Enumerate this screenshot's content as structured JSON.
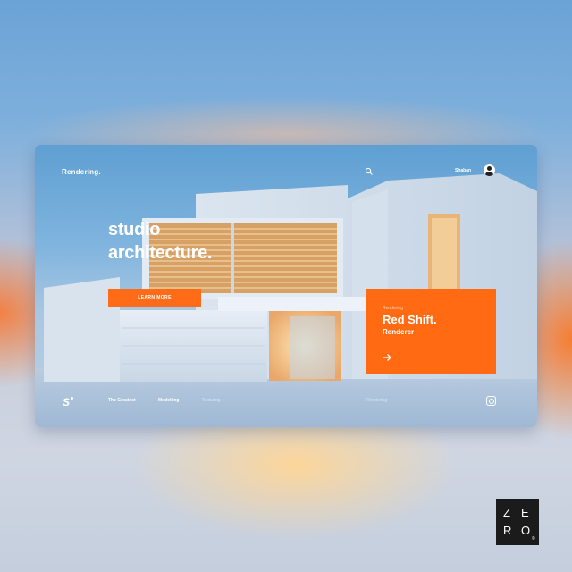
{
  "header": {
    "brand": "Rendering.",
    "user_name": "Shaban"
  },
  "hero": {
    "title_line1": "studio",
    "title_line2": "architecture.",
    "cta_label": "LEARN MORE"
  },
  "promo_card": {
    "kicker": "Rendering",
    "title": "Red Shift.",
    "subtitle": "Renderer"
  },
  "footer_nav": {
    "logo": "S",
    "items": [
      "The Greatest",
      "Modelling",
      "Texturing",
      "Rendering"
    ]
  },
  "watermark": {
    "letters": [
      "Z",
      "E",
      "R",
      "O"
    ],
    "copyright": "©"
  },
  "colors": {
    "accent": "#ff6a12",
    "sky": "#6ba3d6"
  }
}
